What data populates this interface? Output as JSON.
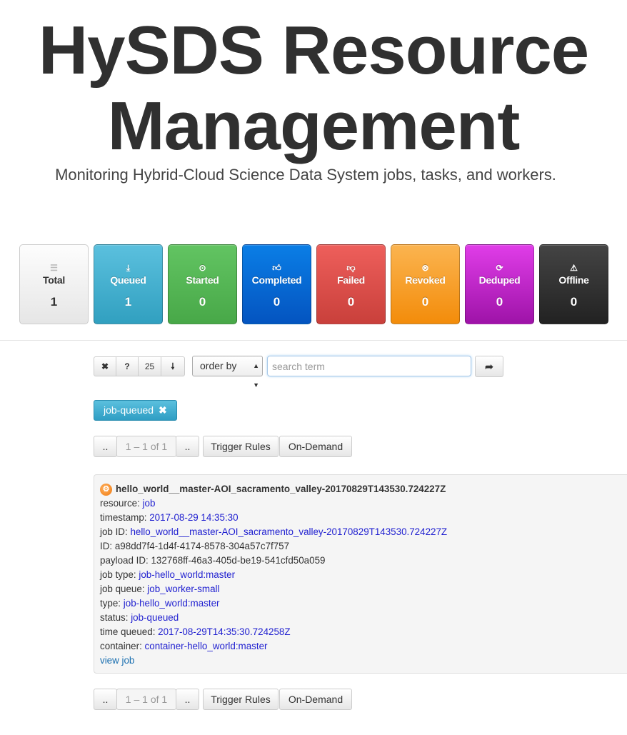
{
  "header": {
    "title_line1": "HySDS Resource",
    "title_line2": "Management",
    "subtitle": "Monitoring Hybrid-Cloud Science Data System jobs, tasks, and workers."
  },
  "tiles": [
    {
      "label": "Total",
      "count": "1",
      "icon": "list-icon"
    },
    {
      "label": "Queued",
      "count": "1",
      "icon": "download-icon"
    },
    {
      "label": "Started",
      "count": "0",
      "icon": "play-circle-icon"
    },
    {
      "label": "Completed",
      "count": "0",
      "icon": "thumbs-up-icon"
    },
    {
      "label": "Failed",
      "count": "0",
      "icon": "thumbs-down-icon"
    },
    {
      "label": "Revoked",
      "count": "0",
      "icon": "remove-circle-icon"
    },
    {
      "label": "Deduped",
      "count": "0",
      "icon": "refresh-icon"
    },
    {
      "label": "Offline",
      "count": "0",
      "icon": "warning-icon"
    }
  ],
  "toolbar": {
    "page_size": "25",
    "order_by": "order by",
    "search_placeholder": "search term"
  },
  "filter": {
    "tag": "job-queued"
  },
  "pager": {
    "prev": "..",
    "range": "1 – 1 of 1",
    "next": "..",
    "trigger_rules": "Trigger Rules",
    "on_demand": "On-Demand"
  },
  "job": {
    "title": "hello_world__master-AOI_sacramento_valley-20170829T143530.724227Z",
    "fields": [
      {
        "key": "resource:",
        "value": "job",
        "link": true
      },
      {
        "key": "timestamp:",
        "value": "2017-08-29 14:35:30",
        "link": true
      },
      {
        "key": "job ID:",
        "value": "hello_world__master-AOI_sacramento_valley-20170829T143530.724227Z",
        "link": true
      },
      {
        "key": "ID:",
        "value": "a98dd7f4-1d4f-4174-8578-304a57c7f757",
        "link": false
      },
      {
        "key": "payload ID:",
        "value": "132768ff-46a3-405d-be19-541cfd50a059",
        "link": false
      },
      {
        "key": "job type:",
        "value": "job-hello_world:master",
        "link": true
      },
      {
        "key": "job queue:",
        "value": "job_worker-small",
        "link": true
      },
      {
        "key": "type:",
        "value": "job-hello_world:master",
        "link": true
      },
      {
        "key": "status:",
        "value": "job-queued",
        "link": true
      },
      {
        "key": "time queued:",
        "value": "2017-08-29T14:35:30.724258Z",
        "link": true
      },
      {
        "key": "container:",
        "value": "container-hello_world:master",
        "link": true
      }
    ],
    "view_link": "view job"
  },
  "colors": {
    "queued": "#5bc0de",
    "started": "#62c462",
    "completed": "#0a7ee6",
    "failed": "#ee5f5b",
    "revoked": "#fbb450",
    "deduped": "#c028ca",
    "offline": "#333333"
  }
}
